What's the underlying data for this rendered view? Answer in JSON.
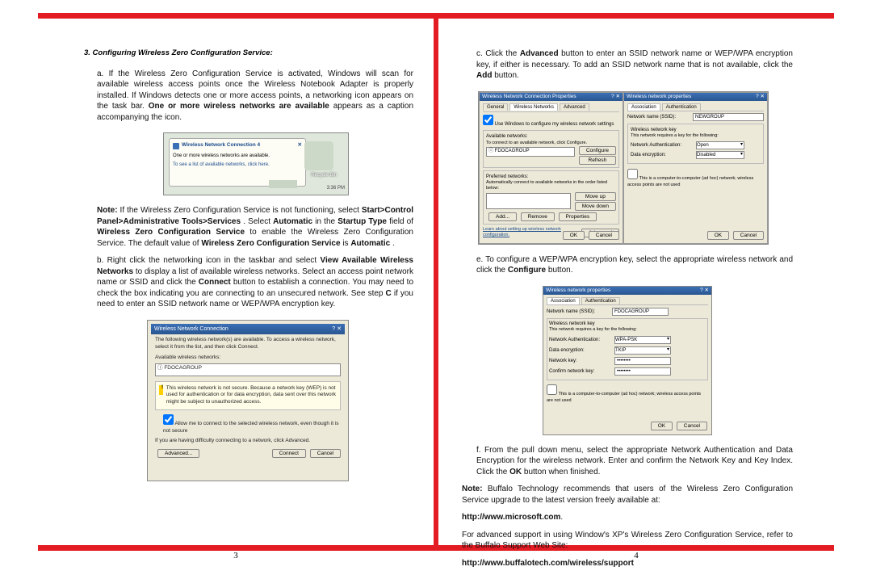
{
  "page_left": "3",
  "page_right": "4",
  "left": {
    "heading": "3. Configuring Wireless Zero Configuration Service:",
    "a_prefix": "a. If the Wireless Zero Configuration Service is activated, Windows will scan for available wireless access points once the Wireless Notebook Adapter is properly installed. If Windows detects one or more access points, a networking icon appears on the task bar. ",
    "a_bold": "One or more wireless networks are available",
    "a_suffix": " appears as a caption accompanying the icon.",
    "fig1": {
      "title": "Wireless Network Connection 4",
      "line1": "One or more wireless networks are available.",
      "line2": "To see a list of available networks, click here.",
      "recycle": "Recycle Bin",
      "clock": "3:36 PM"
    },
    "note1_a": "Note:",
    "note1_b": " If the Wireless Zero Configuration Service is not functioning, select ",
    "note1_c": "Start>Control Panel>Administrative Tools>Services",
    "note1_d": ". Select ",
    "note1_e": "Automatic",
    "note1_f": " in the ",
    "note1_g": "Startup Type",
    "note1_h": " field of ",
    "note1_i": "Wireless Zero Configuration Service",
    "note1_j": " to enable the Wireless Zero Configuration Service. The default value of ",
    "note1_k": "Wireless Zero Configuration Service",
    "note1_l": " is ",
    "note1_m": "Automatic",
    "note1_n": ".",
    "b_a": "b. Right click the networking icon in the taskbar and select ",
    "b_b": "View Available Wireless Networks",
    "b_c": " to display a list of available wireless networks. Select an access point network name or SSID and click the ",
    "b_d": "Connect",
    "b_e": " button to establish a connection. You may need to check the box indicating you are connecting to an unsecured network. See step ",
    "b_f": "C",
    "b_g": " if you need to enter an SSID network name or WEP/WPA encryption key.",
    "fig2": {
      "title": "Wireless Network Connection",
      "intro": "The following wireless network(s) are available. To access a wireless network, select it from the list, and then click Connect.",
      "avail": "Available wireless networks:",
      "item": "FDOCAGROUP",
      "warn": "This wireless network is not secure. Because a network key (WEP) is not used for authentication or for data encryption, data sent over this network might be subject to unauthorized access.",
      "check": "Allow me to connect to the selected wireless network, even though it is not secure",
      "diff": "If you are having difficulty connecting to a network, click Advanced.",
      "adv": "Advanced...",
      "connect": "Connect",
      "cancel": "Cancel"
    }
  },
  "right": {
    "c_a": "c. Click the ",
    "c_b": "Advanced",
    "c_c": " button to enter an SSID network name or WEP/WPA encryption key, if either is necessary. To add an SSID network name that is not available, click the ",
    "c_d": "Add",
    "c_e": " button.",
    "fig3": {
      "left_title": "Wireless Network Connection Properties",
      "tab1": "General",
      "tab2": "Wireless Networks",
      "tab3": "Advanced",
      "usewin": "Use Windows to configure my wireless network settings",
      "avail": "Available networks:",
      "avail_hint": "To connect to an available network, click Configure.",
      "item": "FDOCAGROUP",
      "configure": "Configure",
      "refresh": "Refresh",
      "pref": "Preferred networks:",
      "pref_hint": "Automatically connect to available networks in the order listed below:",
      "moveup": "Move up",
      "movedn": "Move down",
      "add": "Add...",
      "remove": "Remove",
      "props": "Properties",
      "learn": "Learn about setting up wireless network configuration.",
      "advanced": "Advanced",
      "ok": "OK",
      "cancel": "Cancel",
      "right_title": "Wireless network properties",
      "assoc": "Association",
      "auth": "Authentication",
      "ssid_lbl": "Network name (SSID):",
      "ssid_val": "NEWGROUP",
      "wnk": "Wireless network key",
      "req": "This network requires a key for the following:",
      "na_lbl": "Network Authentication:",
      "na_val": "Open",
      "de_lbl": "Data encryption:",
      "de_val": "Disabled",
      "adhoc": "This is a computer-to-computer (ad hoc) network; wireless access points are not used"
    },
    "e_a": "e. To configure a WEP/WPA encryption key, select the appropriate wireless network and click the ",
    "e_b": "Configure",
    "e_c": " button.",
    "fig4": {
      "title": "Wireless network properties",
      "assoc": "Association",
      "auth": "Authentication",
      "ssid_lbl": "Network name (SSID):",
      "ssid_val": "FDOCAGROUP",
      "wnk": "Wireless network key",
      "req": "This network requires a key for the following:",
      "na_lbl": "Network Authentication:",
      "na_val": "WPA-PSK",
      "de_lbl": "Data encryption:",
      "de_val": "TKIP",
      "nk_lbl": "Network key:",
      "nk_val": "••••••••",
      "cnk_lbl": "Confirm network key:",
      "cnk_val": "••••••••",
      "adhoc": "This is a computer-to-computer (ad hoc) network; wireless access points are not used",
      "ok": "OK",
      "cancel": "Cancel"
    },
    "f": "f. From the pull down menu, select the appropriate Network Authentication and Data Encryption for the wireless network. Enter and confirm the Network Key and Key Index. Click the ",
    "f_b": "OK",
    "f_c": " button when finished.",
    "note2_a": "Note:",
    "note2_b": " Buffalo Technology recommends that users of the Wireless Zero Configuration Service upgrade to the latest version freely available at:",
    "url1": "http://www.microsoft.com",
    "note3": "For advanced support in using Window's XP's Wireless Zero Configuration Service, refer to the Buffalo Support Web Site:",
    "url2": "http://www.buffalotech.com/wireless/support"
  }
}
